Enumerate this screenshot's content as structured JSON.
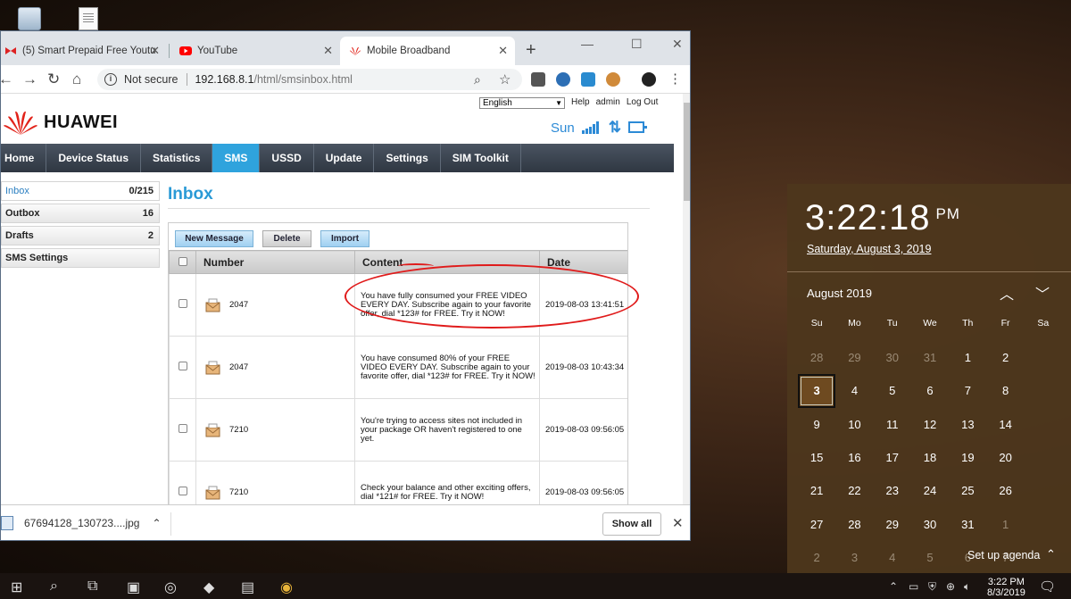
{
  "browser": {
    "tabs": [
      {
        "title": "(5) Smart Prepaid Free Youtu",
        "icon": "dx-red-icon"
      },
      {
        "title": "YouTube",
        "icon": "youtube-icon"
      },
      {
        "title": "Mobile Broadband",
        "icon": "huawei-icon"
      }
    ],
    "address": {
      "security_label": "Not secure",
      "host": "192.168.8.1",
      "path": "/html/smsinbox.html"
    }
  },
  "page": {
    "language": "English",
    "top_links": [
      "Help",
      "admin",
      "Log Out"
    ],
    "brand": "HUAWEI",
    "operator": "Sun",
    "nav": [
      {
        "label": "Home"
      },
      {
        "label": "Device Status"
      },
      {
        "label": "Statistics"
      },
      {
        "label": "SMS"
      },
      {
        "label": "USSD"
      },
      {
        "label": "Update"
      },
      {
        "label": "Settings"
      },
      {
        "label": "SIM Toolkit"
      }
    ],
    "active_nav": "SMS",
    "sidebar": [
      {
        "label": "Inbox",
        "count": "0/215"
      },
      {
        "label": "Outbox",
        "count": "16"
      },
      {
        "label": "Drafts",
        "count": "2"
      },
      {
        "label": "SMS Settings",
        "count": ""
      }
    ],
    "title": "Inbox",
    "buttons": {
      "new": "New Message",
      "delete": "Delete",
      "import": "Import"
    },
    "columns": {
      "number": "Number",
      "content": "Content",
      "date": "Date"
    },
    "messages": [
      {
        "number": "2047",
        "content": "You have fully consumed your FREE VIDEO EVERY DAY. Subscribe again to your favorite offer, dial *123# for FREE. Try it NOW!",
        "date": "2019-08-03 13:41:51"
      },
      {
        "number": "2047",
        "content": "You have consumed 80% of your FREE VIDEO EVERY DAY. Subscribe again to your favorite offer, dial *123# for FREE. Try it NOW!",
        "date": "2019-08-03 10:43:34"
      },
      {
        "number": "7210",
        "content": "You're trying to access sites not included in your package OR haven't registered to one yet.",
        "date": "2019-08-03 09:56:05"
      },
      {
        "number": "7210",
        "content": "Check your balance and other exciting offers, dial *121# for FREE. Try it NOW!",
        "date": "2019-08-03 09:56:05"
      }
    ]
  },
  "downloads": {
    "file": "67694128_130723....jpg",
    "show_all": "Show all"
  },
  "clock": {
    "time": "3:22:18",
    "ampm": "PM",
    "date": "Saturday, August 3, 2019",
    "month": "August 2019",
    "weekdays": [
      "Su",
      "Mo",
      "Tu",
      "We",
      "Th",
      "Fr",
      "Sa"
    ],
    "days": [
      {
        "d": "28",
        "dim": true
      },
      {
        "d": "29",
        "dim": true
      },
      {
        "d": "30",
        "dim": true
      },
      {
        "d": "31",
        "dim": true
      },
      {
        "d": "1"
      },
      {
        "d": "2"
      },
      {
        "d": "3",
        "today": true
      },
      {
        "d": "4"
      },
      {
        "d": "5"
      },
      {
        "d": "6"
      },
      {
        "d": "7"
      },
      {
        "d": "8"
      },
      {
        "d": "9"
      },
      {
        "d": "10"
      },
      {
        "d": "11"
      },
      {
        "d": "12"
      },
      {
        "d": "13"
      },
      {
        "d": "14"
      },
      {
        "d": "15"
      },
      {
        "d": "16"
      },
      {
        "d": "17"
      },
      {
        "d": "18"
      },
      {
        "d": "19"
      },
      {
        "d": "20"
      },
      {
        "d": "21"
      },
      {
        "d": "22"
      },
      {
        "d": "23"
      },
      {
        "d": "24"
      },
      {
        "d": "25"
      },
      {
        "d": "26"
      },
      {
        "d": "27"
      },
      {
        "d": "28"
      },
      {
        "d": "29"
      },
      {
        "d": "30"
      },
      {
        "d": "31"
      },
      {
        "d": "1",
        "dim": true
      },
      {
        "d": "2",
        "dim": true
      },
      {
        "d": "3",
        "dim": true
      },
      {
        "d": "4",
        "dim": true
      },
      {
        "d": "5",
        "dim": true
      },
      {
        "d": "6",
        "dim": true
      },
      {
        "d": "7",
        "dim": true
      }
    ],
    "agenda": "Set up agenda"
  },
  "taskbar": {
    "time": "3:22 PM",
    "date": "8/3/2019"
  },
  "colors": {
    "accent": "#2fa3dd",
    "huawei_red": "#e2231a",
    "annotation": "#e01b1b"
  }
}
